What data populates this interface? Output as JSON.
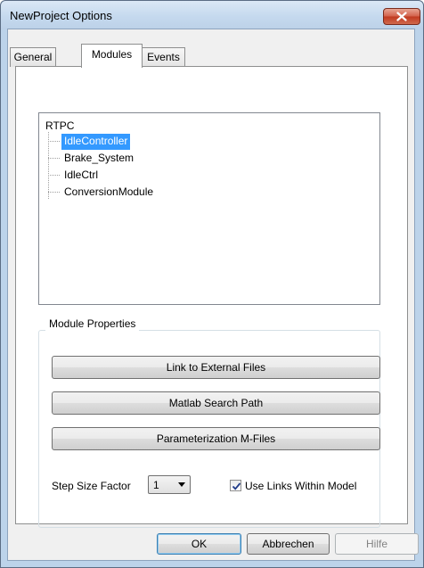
{
  "window": {
    "title": "NewProject Options"
  },
  "tabs": [
    {
      "label": "General",
      "active": false
    },
    {
      "label": "Modules",
      "active": true
    },
    {
      "label": "Events",
      "active": false
    }
  ],
  "tree": {
    "root": "RTPC",
    "items": [
      {
        "label": "IdleController",
        "selected": true
      },
      {
        "label": "Brake_System",
        "selected": false
      },
      {
        "label": "IdleCtrl",
        "selected": false
      },
      {
        "label": "ConversionModule",
        "selected": false
      }
    ]
  },
  "module_properties": {
    "title": "Module Properties",
    "buttons": {
      "link_external": "Link to External Files",
      "matlab_path": "Matlab Search Path",
      "parameterization": "Parameterization M-Files"
    },
    "step_size_label": "Step Size Factor",
    "step_size_value": "1",
    "use_links_label": "Use Links Within Model",
    "use_links_checked": true
  },
  "footer": {
    "ok": "OK",
    "cancel": "Abbrechen",
    "help": "Hilfe"
  },
  "icons": {
    "close": "close-icon",
    "dropdown": "chevron-down-icon",
    "check": "check-icon"
  },
  "colors": {
    "selection": "#3399ff",
    "close_button": "#c0391f",
    "title_bar": "#c5d9ee"
  }
}
